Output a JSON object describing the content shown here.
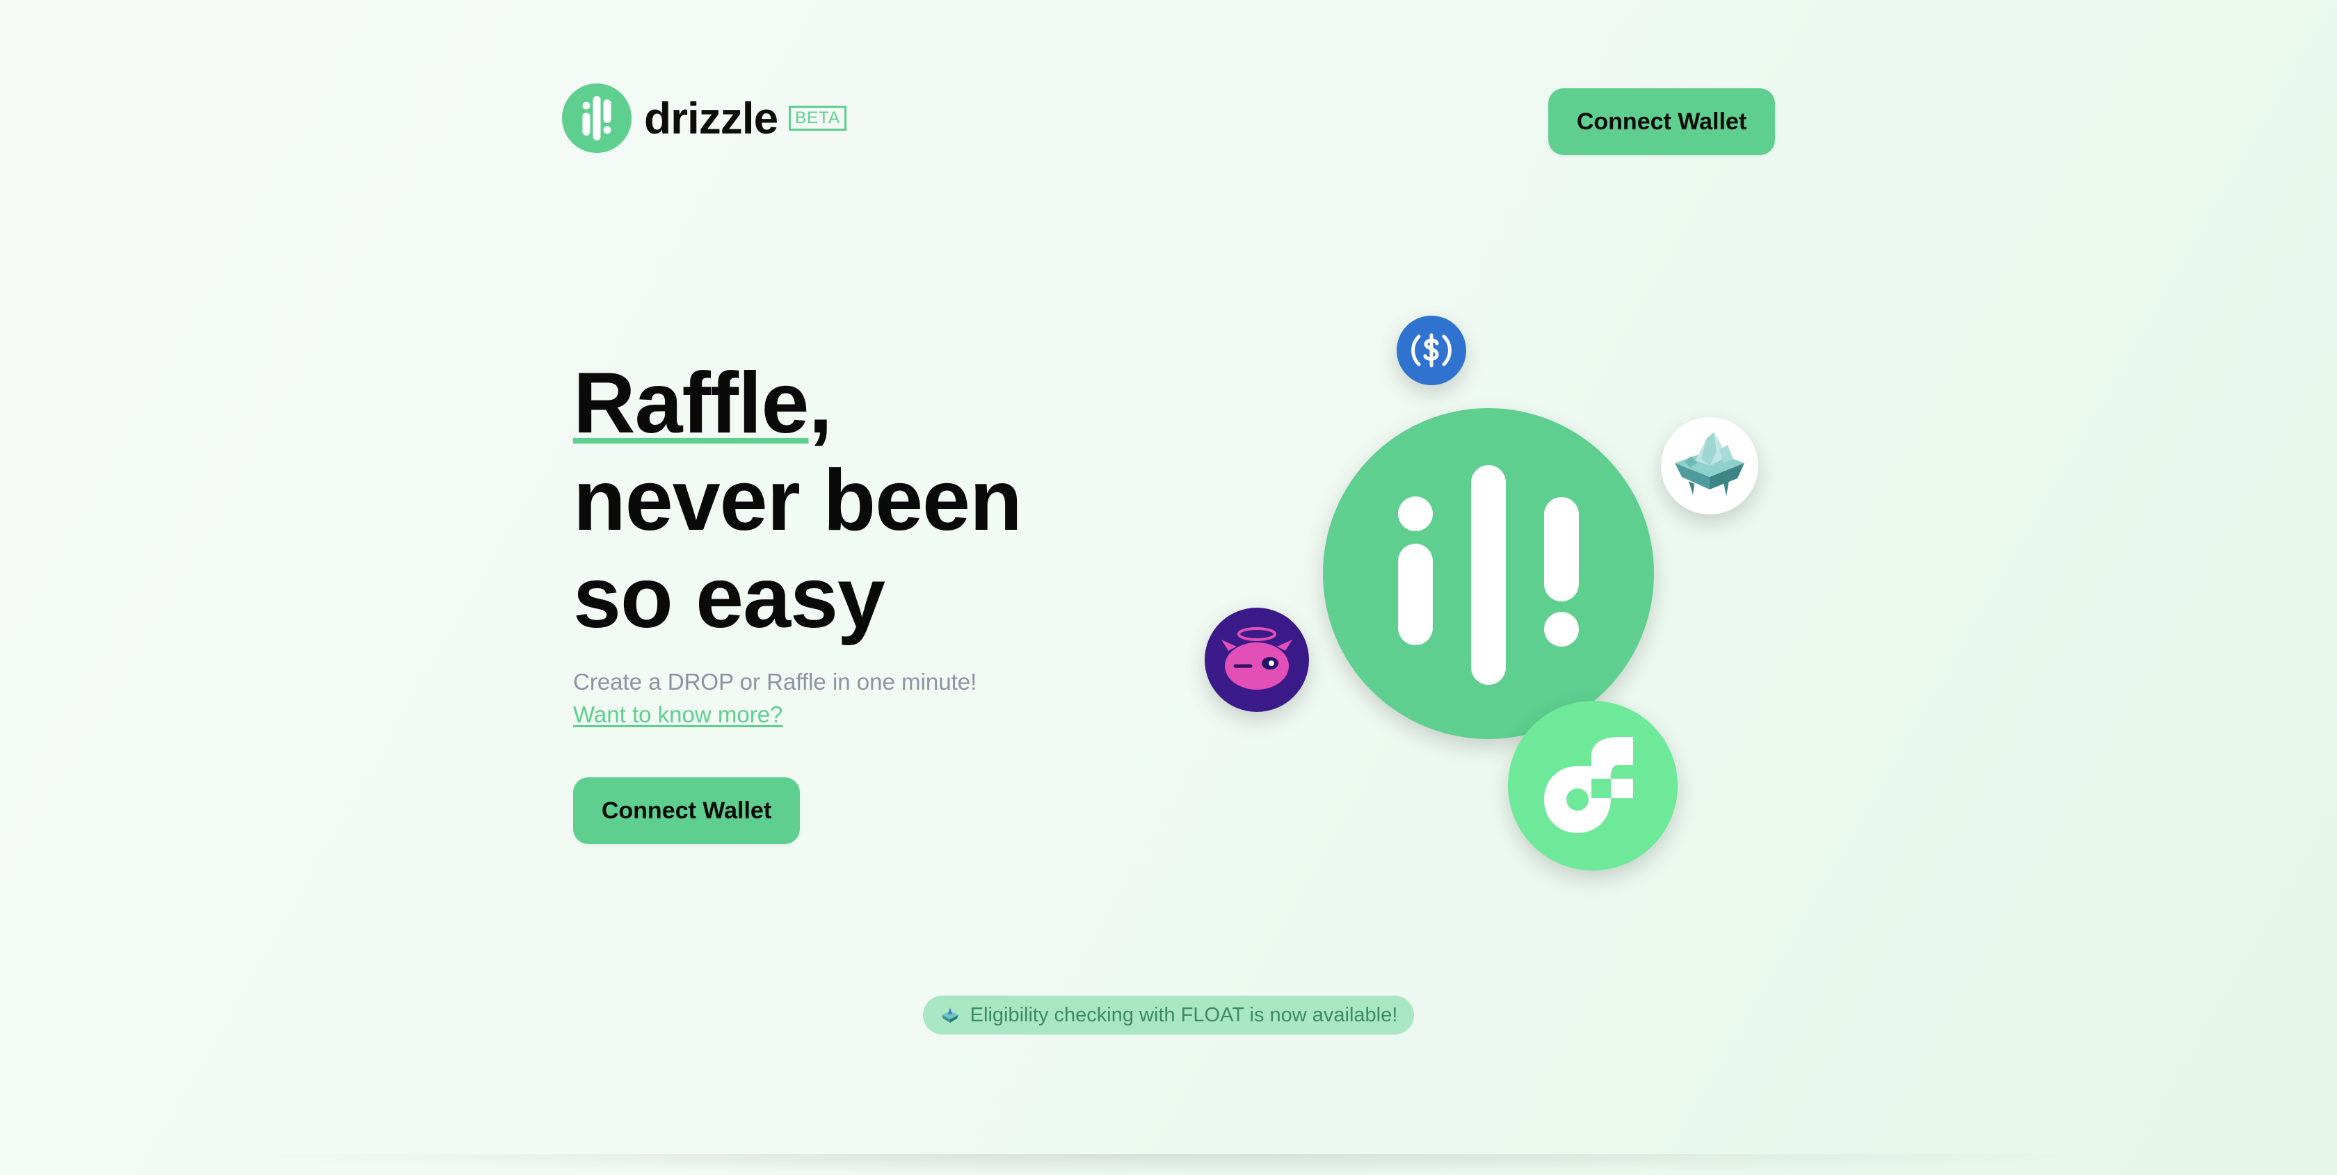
{
  "header": {
    "brand": "drizzle",
    "badge": "BETA",
    "connect_label": "Connect Wallet"
  },
  "hero": {
    "headline_word": "Raffle",
    "headline_comma": ",",
    "headline_line2": "never been",
    "headline_line3": "so easy",
    "subtitle": "Create a DROP or Raffle in one minute!",
    "link": "Want to know more?",
    "connect_label": "Connect Wallet"
  },
  "banner": {
    "text": "Eligibility checking with FLOAT is now available!"
  },
  "icons": {
    "logo": "drizzle-logo-icon",
    "usdc": "usdc-coin-icon",
    "island": "floating-island-icon",
    "mascot": "purple-mascot-icon",
    "flow": "flow-logo-icon",
    "float": "float-icon"
  },
  "colors": {
    "accent": "#5ecf8f",
    "flow_green": "#6ee899",
    "usdc_blue": "#2f72d0",
    "mascot_purple": "#3b1a8a",
    "banner_bg": "#a8e7c2",
    "banner_text": "#3c8a64",
    "subtitle_gray": "#8b94a3"
  }
}
